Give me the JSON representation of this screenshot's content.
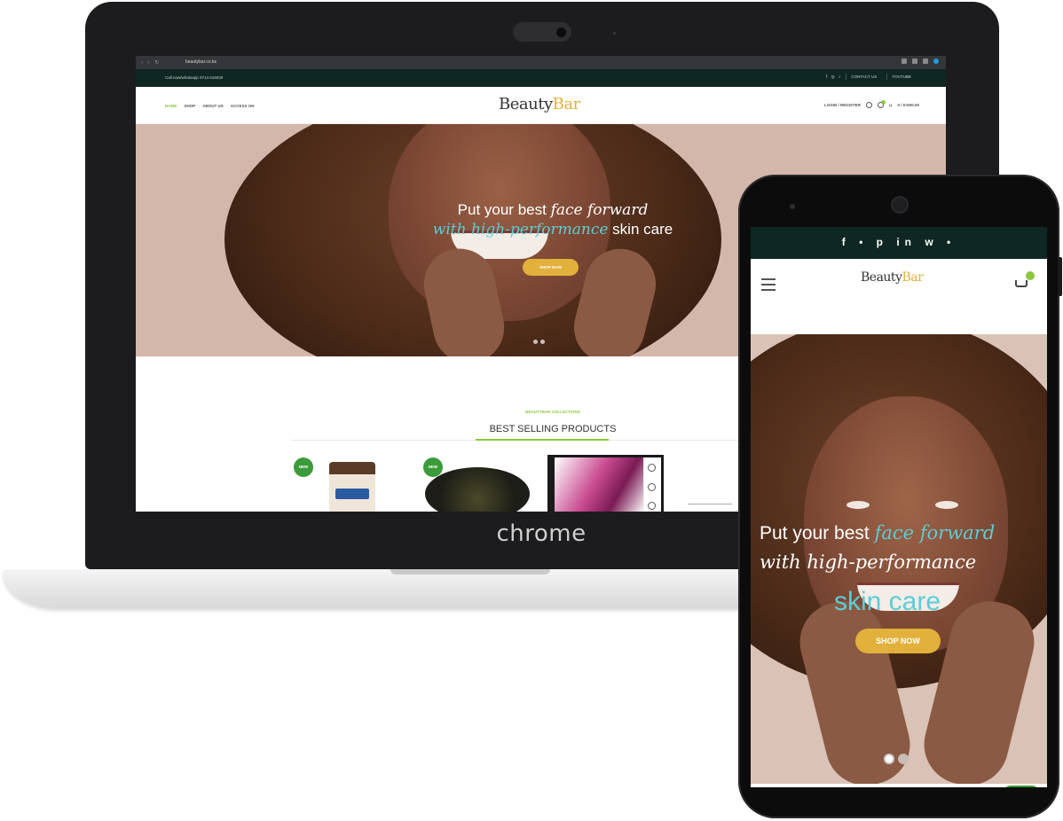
{
  "laptop": {
    "device_label": "chrome",
    "browser": {
      "url": "beautybar.co.ke"
    },
    "topbar": {
      "call_text": "Call now/whatsapp 0714 616030",
      "social_icons": [
        "facebook-icon",
        "instagram-icon",
        "tiktok-icon"
      ],
      "links": [
        "CONTACT US",
        "YOUTUBE"
      ]
    },
    "nav": {
      "links": [
        "HOME",
        "SHOP",
        "ABOUT US",
        "ACCESS ON"
      ],
      "active_link": "HOME",
      "account": "LOGIN / REGISTER",
      "cart_total": "0 / KSH0.00"
    },
    "logo": {
      "part1": "Beauty",
      "part2": "Bar"
    },
    "hero": {
      "line1_plain": "Put your best",
      "line1_script": "face forward",
      "line2_script": "with high-performance",
      "line2_plain": "skin care",
      "button": "SHOP NOW"
    },
    "section": {
      "kicker": "BEAUTYBAR COLLECTIONS",
      "title": "BEST SELLING PRODUCTS",
      "badge": "NEW"
    }
  },
  "phone": {
    "social_icons_text": "f  •  p  in  w  •",
    "logo": {
      "part1": "Beauty",
      "part2": "Bar"
    },
    "hero": {
      "line1_plain": "Put your best",
      "line1_script": "face forward",
      "line2_script": "with high-performance",
      "line3": "skin care",
      "button": "SHOP NOW"
    }
  },
  "colors": {
    "brand_green": "#8dc63f",
    "brand_gold": "#e1b13b",
    "teal_accent": "#5ccdd6",
    "topbar_dark": "#0e2723"
  }
}
